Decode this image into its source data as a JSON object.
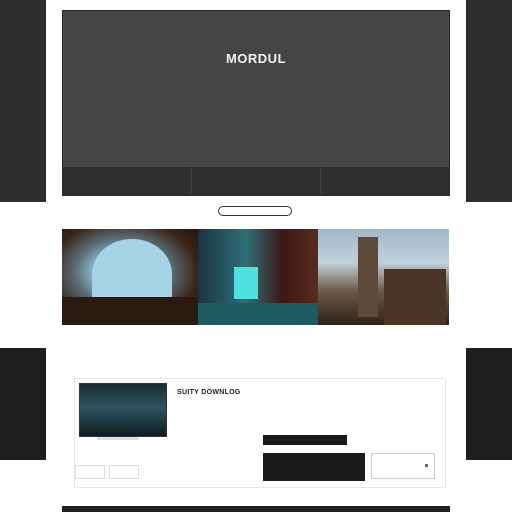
{
  "hero": {
    "title": "MORDUL",
    "subtitle": "",
    "lines": [
      "",
      "",
      ""
    ],
    "nav": [
      "",
      "",
      ""
    ]
  },
  "section": {
    "pill_label": ""
  },
  "gallery": {
    "items": [
      {
        "title": "",
        "text_lines": [
          "",
          "",
          ""
        ]
      },
      {
        "title": "",
        "text_lines": [
          "",
          "",
          ""
        ]
      },
      {
        "title": "",
        "text_lines": [
          "",
          "",
          ""
        ]
      }
    ]
  },
  "card": {
    "title": "SUITY DOWNLOG",
    "description": "",
    "description2": "",
    "button_label": "",
    "thumb_labels": [
      "",
      ""
    ]
  },
  "colors": {
    "hero_bg": "#454545",
    "nav_bg": "#2f2f2f",
    "accent_dark": "#1b1b1b"
  }
}
